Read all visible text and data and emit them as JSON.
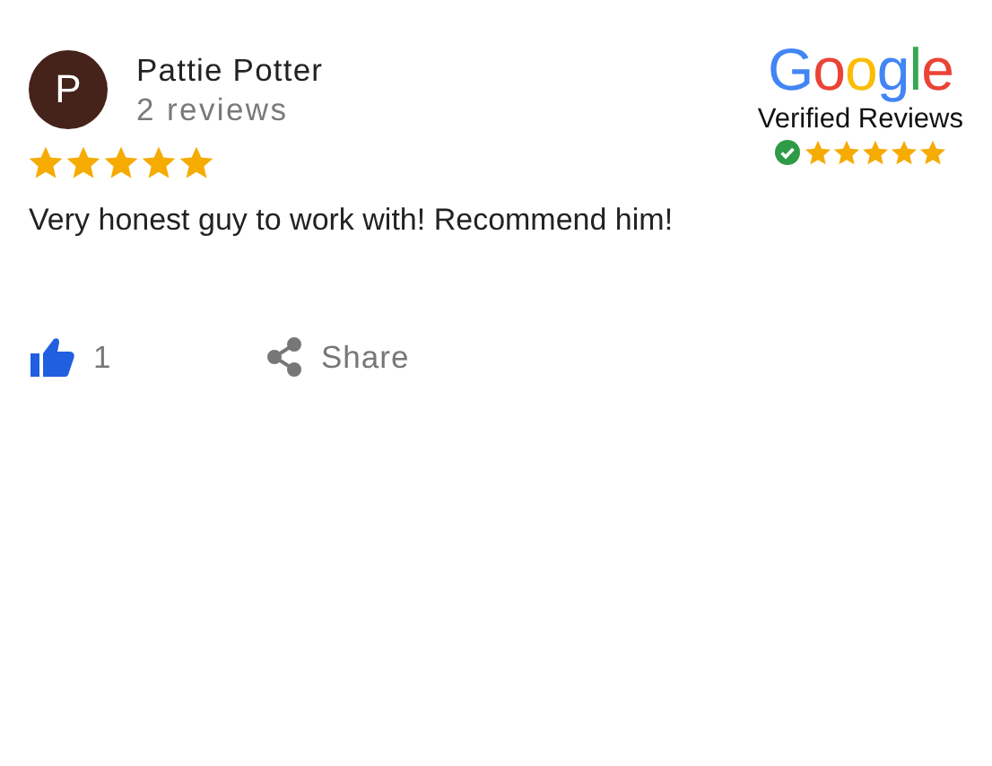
{
  "review": {
    "avatar_letter": "P",
    "author": "Pattie Potter",
    "review_count": "2 reviews",
    "stars": 5,
    "text": "Very honest guy to work with! Recommend him!"
  },
  "badge": {
    "logo": "Google",
    "caption": "Verified Reviews",
    "verified": true,
    "stars": 5
  },
  "actions": {
    "like_count": "1",
    "share_label": "Share"
  }
}
